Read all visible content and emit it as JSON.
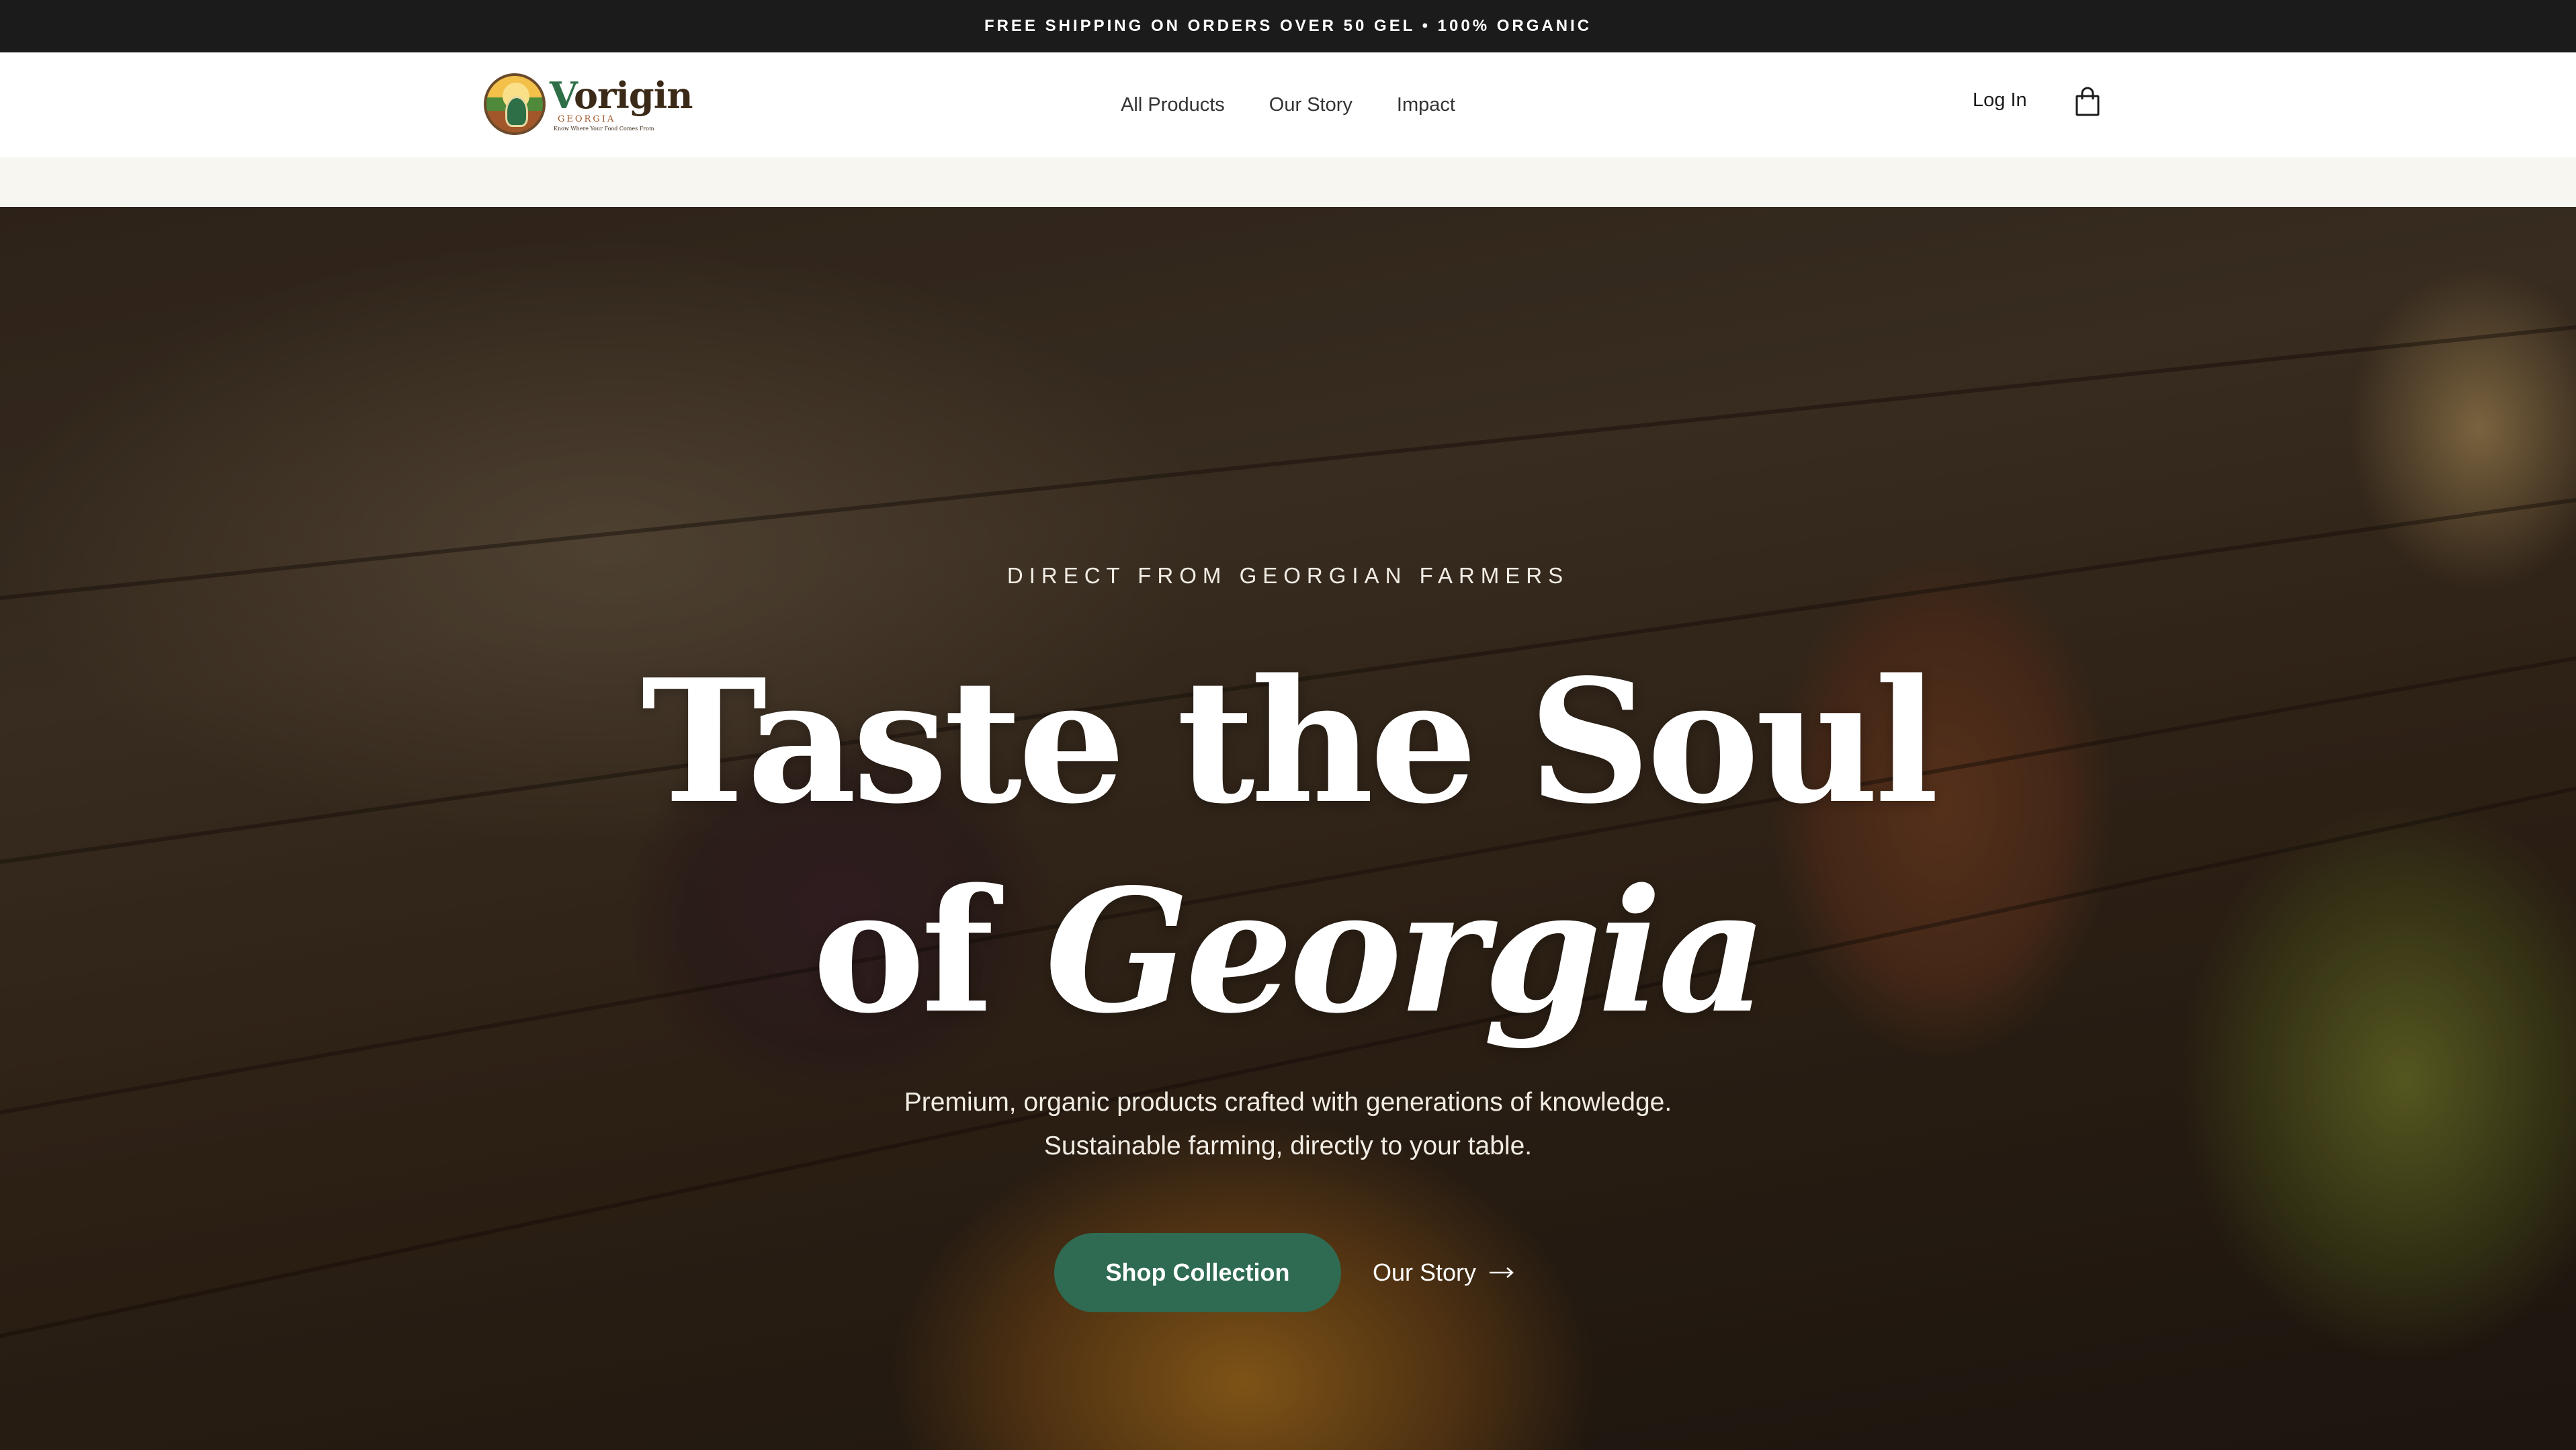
{
  "announcement": {
    "text": "FREE SHIPPING ON ORDERS OVER 50 GEL • 100% ORGANIC"
  },
  "header": {
    "logo": {
      "word_initial": "V",
      "word_rest": "origin",
      "sub": "GEORGIA",
      "tagline": "Know Where Your Food Comes From"
    },
    "nav": [
      {
        "label": "All Products"
      },
      {
        "label": "Our Story"
      },
      {
        "label": "Impact"
      }
    ],
    "login_label": "Log In",
    "cart_icon": "shopping-bag-icon"
  },
  "hero": {
    "eyebrow": "DIRECT FROM GEORGIAN FARMERS",
    "headline_line1": "Taste the Soul",
    "headline_line2_plain": "of",
    "headline_line2_italic": "Georgia",
    "subtext_line1": "Premium, organic products crafted with generations of knowledge.",
    "subtext_line2": "Sustainable farming, directly to your table.",
    "primary_cta": "Shop Collection",
    "secondary_cta": "Our Story",
    "secondary_cta_icon": "arrow-right-icon"
  },
  "colors": {
    "announcement_bg": "#1b1b1b",
    "primary_button": "#2e6b52",
    "header_bg": "#ffffff"
  }
}
